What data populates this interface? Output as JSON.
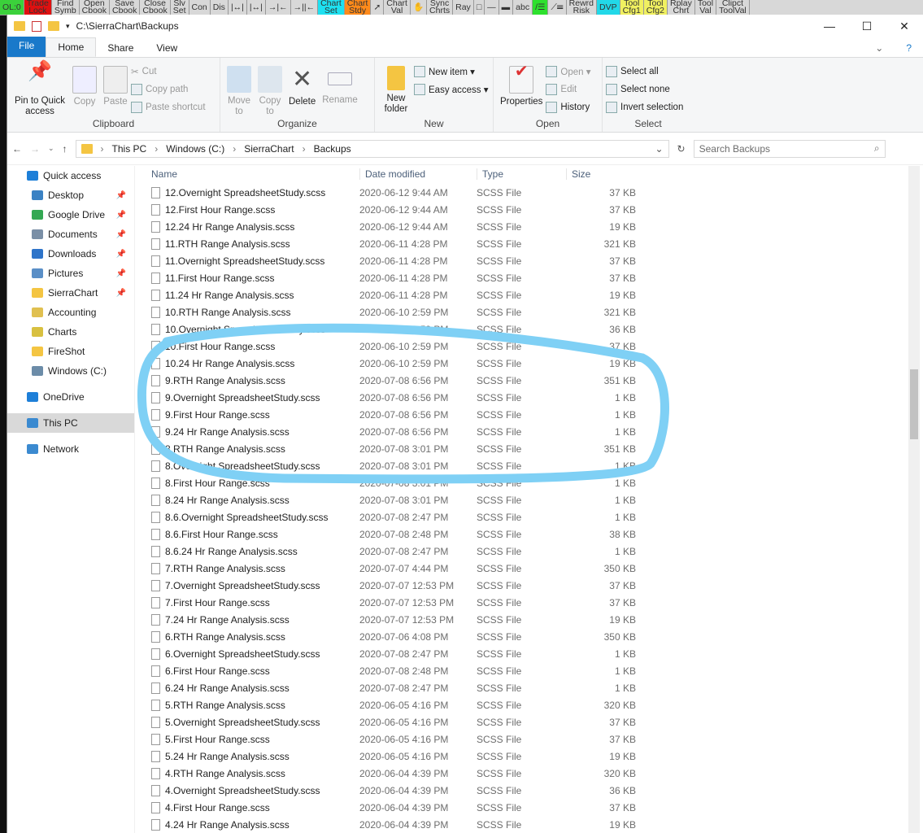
{
  "sierra_toolbar": [
    "OL:0",
    "Trade\nLock",
    "Find\nSymb",
    "Open\nCbook",
    "Save\nCbook",
    "Close\nCbook",
    "Slv\nSet",
    "Con",
    "Dis",
    "|↔|",
    "|↔|",
    "→|←",
    "→||←",
    "Chart\nSet",
    "Chart\nStdy",
    "➚",
    "Chart\nVal",
    "✋",
    "Sync\nChrts",
    "Ray",
    "□",
    "—",
    "▬",
    "abc",
    "/☰",
    "⟋☰",
    "Rewrd\nRisk",
    "DVP",
    "Tool\nCfg1",
    "Tool\nCfg2",
    "Rplay\nChrt",
    "Tool\nVal",
    "Clipct\nToolVal"
  ],
  "title": "C:\\SierraChart\\Backups",
  "tabs": [
    "File",
    "Home",
    "Share",
    "View"
  ],
  "ribbon": {
    "clipboard": {
      "label": "Clipboard",
      "pin": "Pin to Quick access",
      "copy": "Copy",
      "paste": "Paste",
      "cut": "Cut",
      "copy_path": "Copy path",
      "paste_shortcut": "Paste shortcut"
    },
    "organize": {
      "label": "Organize",
      "move": "Move to",
      "copy": "Copy to",
      "delete": "Delete",
      "rename": "Rename"
    },
    "new": {
      "label": "New",
      "folder": "New folder",
      "item": "New item ▾",
      "easy": "Easy access ▾"
    },
    "open": {
      "label": "Open",
      "properties": "Properties",
      "open": "Open ▾",
      "edit": "Edit",
      "history": "History"
    },
    "select": {
      "label": "Select",
      "all": "Select all",
      "none": "Select none",
      "invert": "Invert selection"
    }
  },
  "address": {
    "crumbs": [
      "This PC",
      "Windows (C:)",
      "SierraChart",
      "Backups"
    ],
    "search_placeholder": "Search Backups"
  },
  "nav": [
    {
      "label": "Quick access",
      "color": "#1e7fd8",
      "pin": false,
      "indent": false
    },
    {
      "label": "Desktop",
      "color": "#3b82c4",
      "pin": true
    },
    {
      "label": "Google Drive",
      "color": "#34a853",
      "pin": true
    },
    {
      "label": "Documents",
      "color": "#7a8fa6",
      "pin": true
    },
    {
      "label": "Downloads",
      "color": "#2e74c9",
      "pin": true
    },
    {
      "label": "Pictures",
      "color": "#5a8fc7",
      "pin": true
    },
    {
      "label": "SierraChart",
      "color": "#f4c542",
      "pin": true
    },
    {
      "label": "Accounting",
      "color": "#e0c050",
      "pin": false
    },
    {
      "label": "Charts",
      "color": "#d8c040",
      "pin": false
    },
    {
      "label": "FireShot",
      "color": "#f4c542",
      "pin": false
    },
    {
      "label": "Windows (C:)",
      "color": "#6c8ca8",
      "pin": false
    },
    {
      "label": "OneDrive",
      "color": "#1e7fd8",
      "pin": false,
      "gap": true,
      "indent": false
    },
    {
      "label": "This PC",
      "color": "#3b8ad0",
      "pin": false,
      "gap": true,
      "indent": false,
      "selected": true
    },
    {
      "label": "Network",
      "color": "#3b8ad0",
      "pin": false,
      "gap": true,
      "indent": false
    }
  ],
  "columns": [
    "Name",
    "Date modified",
    "Type",
    "Size"
  ],
  "files": [
    [
      "12.Overnight SpreadsheetStudy.scss",
      "2020-06-12 9:44 AM",
      "SCSS File",
      "37 KB"
    ],
    [
      "12.First Hour Range.scss",
      "2020-06-12 9:44 AM",
      "SCSS File",
      "37 KB"
    ],
    [
      "12.24 Hr Range Analysis.scss",
      "2020-06-12 9:44 AM",
      "SCSS File",
      "19 KB"
    ],
    [
      "11.RTH Range Analysis.scss",
      "2020-06-11 4:28 PM",
      "SCSS File",
      "321 KB"
    ],
    [
      "11.Overnight SpreadsheetStudy.scss",
      "2020-06-11 4:28 PM",
      "SCSS File",
      "37 KB"
    ],
    [
      "11.First Hour Range.scss",
      "2020-06-11 4:28 PM",
      "SCSS File",
      "37 KB"
    ],
    [
      "11.24 Hr Range Analysis.scss",
      "2020-06-11 4:28 PM",
      "SCSS File",
      "19 KB"
    ],
    [
      "10.RTH Range Analysis.scss",
      "2020-06-10 2:59 PM",
      "SCSS File",
      "321 KB"
    ],
    [
      "10.Overnight SpreadsheetStudy.scss",
      "2020-06-10 2:59 PM",
      "SCSS File",
      "36 KB"
    ],
    [
      "10.First Hour Range.scss",
      "2020-06-10 2:59 PM",
      "SCSS File",
      "37 KB"
    ],
    [
      "10.24 Hr Range Analysis.scss",
      "2020-06-10 2:59 PM",
      "SCSS File",
      "19 KB"
    ],
    [
      "9.RTH Range Analysis.scss",
      "2020-07-08 6:56 PM",
      "SCSS File",
      "351 KB"
    ],
    [
      "9.Overnight SpreadsheetStudy.scss",
      "2020-07-08 6:56 PM",
      "SCSS File",
      "1 KB"
    ],
    [
      "9.First Hour Range.scss",
      "2020-07-08 6:56 PM",
      "SCSS File",
      "1 KB"
    ],
    [
      "9.24 Hr Range Analysis.scss",
      "2020-07-08 6:56 PM",
      "SCSS File",
      "1 KB"
    ],
    [
      "8.RTH Range Analysis.scss",
      "2020-07-08 3:01 PM",
      "SCSS File",
      "351 KB"
    ],
    [
      "8.Overnight SpreadsheetStudy.scss",
      "2020-07-08 3:01 PM",
      "SCSS File",
      "1 KB"
    ],
    [
      "8.First Hour Range.scss",
      "2020-07-08 3:01 PM",
      "SCSS File",
      "1 KB"
    ],
    [
      "8.24 Hr Range Analysis.scss",
      "2020-07-08 3:01 PM",
      "SCSS File",
      "1 KB"
    ],
    [
      "8.6.Overnight SpreadsheetStudy.scss",
      "2020-07-08 2:47 PM",
      "SCSS File",
      "1 KB"
    ],
    [
      "8.6.First Hour Range.scss",
      "2020-07-08 2:48 PM",
      "SCSS File",
      "38 KB"
    ],
    [
      "8.6.24 Hr Range Analysis.scss",
      "2020-07-08 2:47 PM",
      "SCSS File",
      "1 KB"
    ],
    [
      "7.RTH Range Analysis.scss",
      "2020-07-07 4:44 PM",
      "SCSS File",
      "350 KB"
    ],
    [
      "7.Overnight SpreadsheetStudy.scss",
      "2020-07-07 12:53 PM",
      "SCSS File",
      "37 KB"
    ],
    [
      "7.First Hour Range.scss",
      "2020-07-07 12:53 PM",
      "SCSS File",
      "37 KB"
    ],
    [
      "7.24 Hr Range Analysis.scss",
      "2020-07-07 12:53 PM",
      "SCSS File",
      "19 KB"
    ],
    [
      "6.RTH Range Analysis.scss",
      "2020-07-06 4:08 PM",
      "SCSS File",
      "350 KB"
    ],
    [
      "6.Overnight SpreadsheetStudy.scss",
      "2020-07-08 2:47 PM",
      "SCSS File",
      "1 KB"
    ],
    [
      "6.First Hour Range.scss",
      "2020-07-08 2:48 PM",
      "SCSS File",
      "1 KB"
    ],
    [
      "6.24 Hr Range Analysis.scss",
      "2020-07-08 2:47 PM",
      "SCSS File",
      "1 KB"
    ],
    [
      "5.RTH Range Analysis.scss",
      "2020-06-05 4:16 PM",
      "SCSS File",
      "320 KB"
    ],
    [
      "5.Overnight SpreadsheetStudy.scss",
      "2020-06-05 4:16 PM",
      "SCSS File",
      "37 KB"
    ],
    [
      "5.First Hour Range.scss",
      "2020-06-05 4:16 PM",
      "SCSS File",
      "37 KB"
    ],
    [
      "5.24 Hr Range Analysis.scss",
      "2020-06-05 4:16 PM",
      "SCSS File",
      "19 KB"
    ],
    [
      "4.RTH Range Analysis.scss",
      "2020-06-04 4:39 PM",
      "SCSS File",
      "320 KB"
    ],
    [
      "4.Overnight SpreadsheetStudy.scss",
      "2020-06-04 4:39 PM",
      "SCSS File",
      "36 KB"
    ],
    [
      "4.First Hour Range.scss",
      "2020-06-04 4:39 PM",
      "SCSS File",
      "37 KB"
    ],
    [
      "4.24 Hr Range Analysis.scss",
      "2020-06-04 4:39 PM",
      "SCSS File",
      "19 KB"
    ]
  ],
  "colors": {
    "file_tab": "#1979ca",
    "annotation": "#7fd0f5"
  }
}
